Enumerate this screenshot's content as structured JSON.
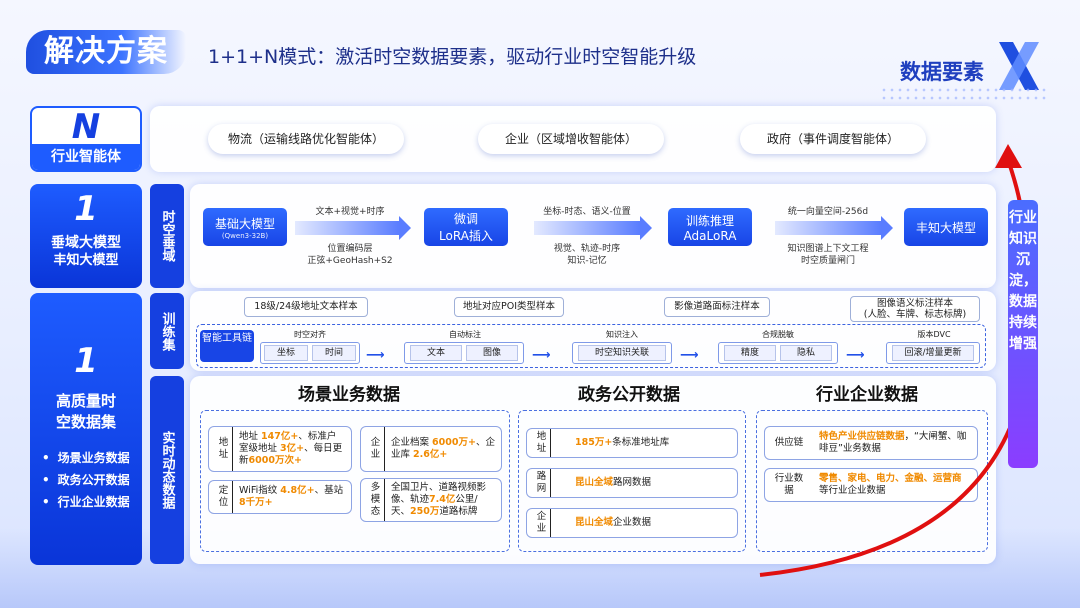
{
  "header": {
    "title": "解决方案",
    "subtitle": "1+1+N模式：激活时空数据要素，驱动行业时空智能升级",
    "brand": "数据要素"
  },
  "left": {
    "n": {
      "big": "N",
      "label": "行业智能体"
    },
    "one_model": {
      "big": "1",
      "label1": "垂域大模型",
      "label2": "丰知大模型"
    },
    "one_data": {
      "big": "1",
      "label1": "高质量时",
      "label2": "空数据集",
      "bullets": [
        "场景业务数据",
        "政务公开数据",
        "行业企业数据"
      ]
    }
  },
  "vlabels": {
    "spatial": "时空垂域",
    "train": "训练集",
    "realtime": "实时动态数据"
  },
  "agents": [
    "物流（运输线路优化智能体）",
    "企业（区域增收智能体）",
    "政府（事件调度智能体）"
  ],
  "pipeline": {
    "base": {
      "title": "基础大模型",
      "sub": "(Qwen3-32B)"
    },
    "step1_top": "文本+视觉+时序",
    "step1_bot1": "位置编码层",
    "step1_bot2": "正弦+GeoHash+S2",
    "finetune1": "微调",
    "finetune2": "LoRA插入",
    "step2_top": "坐标-时态、语义-位置",
    "step2_bot1": "视觉、轨迹-时序",
    "step2_bot2": "知识-记忆",
    "infer1": "训练推理",
    "infer2": "AdaLoRA",
    "step3_top": "统一向量空间-256d",
    "step3_bot1": "知识图谱上下文工程",
    "step3_bot2": "时空质量闸门",
    "final": "丰知大模型"
  },
  "samples": [
    "18级/24级地址文本样本",
    "地址对应POI类型样本",
    "影像道路面标注样本",
    "图像语义标注样本",
    "(人脸、车牌、标志标牌)"
  ],
  "toolchain": {
    "label": "智能工具链",
    "stages": [
      {
        "name": "时空对齐",
        "chips": [
          "坐标",
          "时间"
        ]
      },
      {
        "name": "自动标注",
        "chips": [
          "文本",
          "图像"
        ]
      },
      {
        "name": "知识注入",
        "chips": [
          "时空知识关联"
        ]
      },
      {
        "name": "合规脱敏",
        "chips": [
          "精度",
          "隐私"
        ]
      },
      {
        "name": "版本DVC",
        "chips": [
          "回滚/增量更新"
        ]
      }
    ]
  },
  "sections": {
    "scene": {
      "title": "场景业务数据",
      "cards": [
        {
          "label": "地址",
          "t1": "地址 ",
          "h1": "147亿+",
          "t2": "、标准户室级地址 ",
          "h2": "3亿+",
          "t3": "、每日更新",
          "h3": "6000万次+",
          "t4": ""
        },
        {
          "label": "定位",
          "t1": "WiFi指纹 ",
          "h1": "4.8亿+",
          "t2": "、基站 ",
          "h2": "8千万+",
          "t3": "",
          "h3": "",
          "t4": ""
        },
        {
          "label": "企业",
          "t1": "企业档案 ",
          "h1": "6000万+",
          "t2": "、企业库 ",
          "h2": "2.6亿+",
          "t3": "",
          "h3": "",
          "t4": ""
        },
        {
          "label": "多模态",
          "t1": "全国卫片、道路视频影像、轨迹",
          "h1": "7.4亿",
          "t2": "公里/天、",
          "h2": "250万",
          "t3": "道路标牌",
          "h3": "",
          "t4": ""
        }
      ]
    },
    "gov": {
      "title": "政务公开数据",
      "cards": [
        {
          "label": "地址",
          "h1": "185万+",
          "t1": "条标准地址库"
        },
        {
          "label": "路网",
          "h1": "昆山全域",
          "t1": "路网数据"
        },
        {
          "label": "企业",
          "h1": "昆山全域",
          "t1": "企业数据"
        }
      ]
    },
    "ind": {
      "title": "行业企业数据",
      "cards": [
        {
          "label": "供应链",
          "h1": "特色产业供应链数据",
          "t1": "，“大闸蟹、咖啡豆”业务数据"
        },
        {
          "label": "行业数据",
          "h1": "零售、家电、电力、金融、运营商",
          "t1": "等行业企业数据"
        }
      ]
    }
  },
  "right_label": "行业知识沉淀，数据持续增强",
  "colors": {
    "primary": "#1845e6",
    "highlight": "#f08a00",
    "arc": "#e01010"
  }
}
